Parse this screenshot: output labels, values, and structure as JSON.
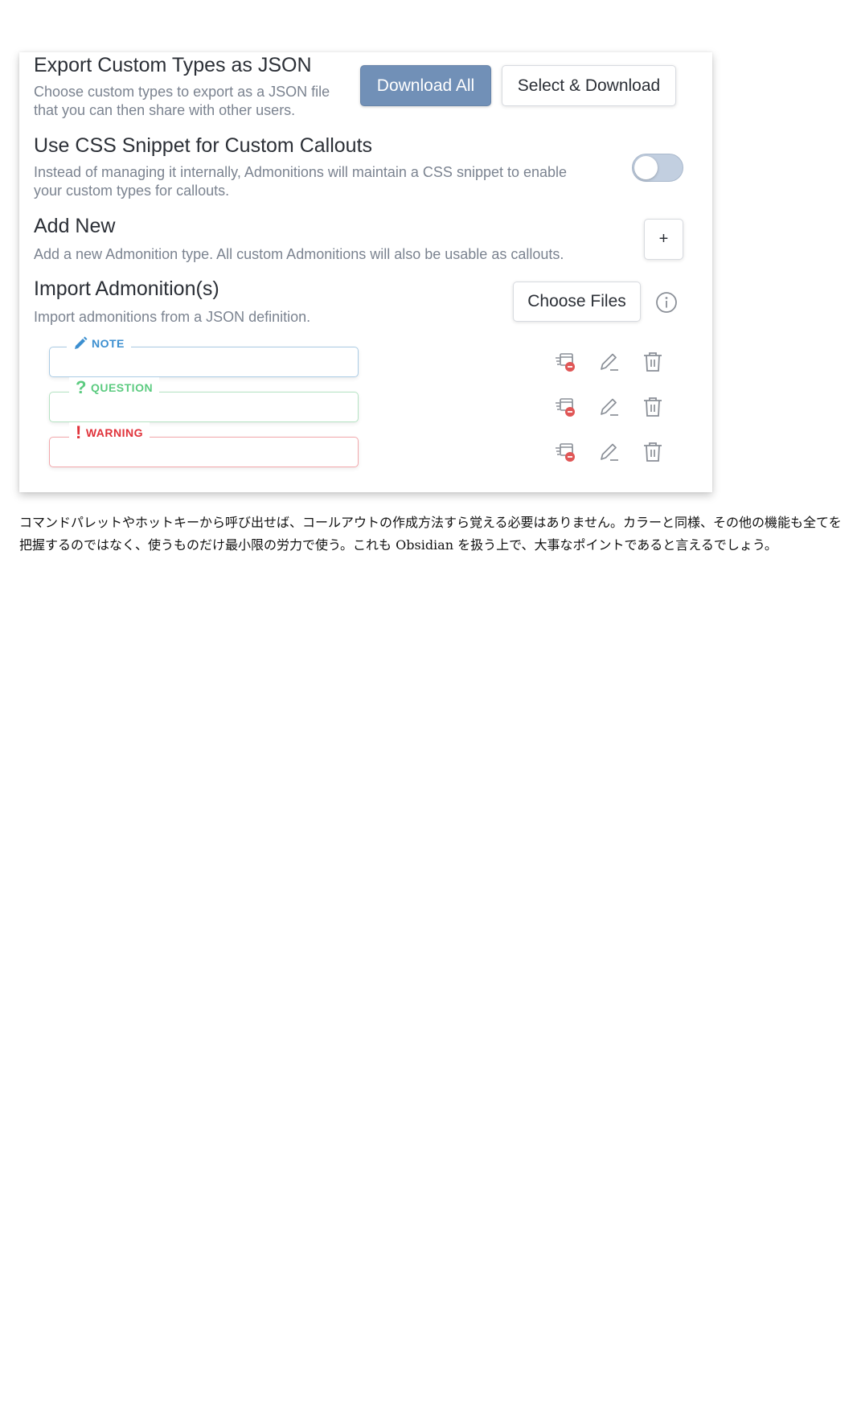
{
  "export": {
    "title": "Export Custom Types as JSON",
    "desc_line1": "Choose custom types to export as a JSON file",
    "desc_line2": "that you can then share with other users.",
    "download_all": "Download All",
    "select_download": "Select & Download"
  },
  "css_snippet": {
    "title": "Use CSS Snippet for Custom Callouts",
    "desc_line1": "Instead of managing it internally, Admonitions will maintain a CSS snippet to enable",
    "desc_line2": "your custom types for callouts.",
    "enabled": false
  },
  "add_new": {
    "title": "Add New",
    "desc": "Add a new Admonition type. All custom Admonitions will also be usable as callouts.",
    "button": "+"
  },
  "import": {
    "title": "Import Admonition(s)",
    "desc": "Import admonitions from a JSON definition.",
    "button": "Choose Files"
  },
  "admonitions": [
    {
      "label": "NOTE",
      "color": "#3c8fd0",
      "icon": "pencil-icon"
    },
    {
      "label": "QUESTION",
      "color": "#5ccb80",
      "icon": "question-icon"
    },
    {
      "label": "WARNING",
      "color": "#e0323a",
      "icon": "exclamation-icon"
    }
  ],
  "colors": {
    "accent": "#7190b7",
    "note": "#3c8fd0",
    "question": "#5ccb80",
    "warning": "#e0323a",
    "remove_badge": "#e05656"
  },
  "paragraph": {
    "line1": "コマンドパレットやホットキーから呼び出せば、コールアウトの作成方法すら覚える必要はありません。カラーと同様、その他の機能も全てを",
    "line2": "把握するのではなく、使うものだけ最小限の労力で使う。これも Obsidian を扱う上で、大事なポイントであると言えるでしょう。"
  }
}
